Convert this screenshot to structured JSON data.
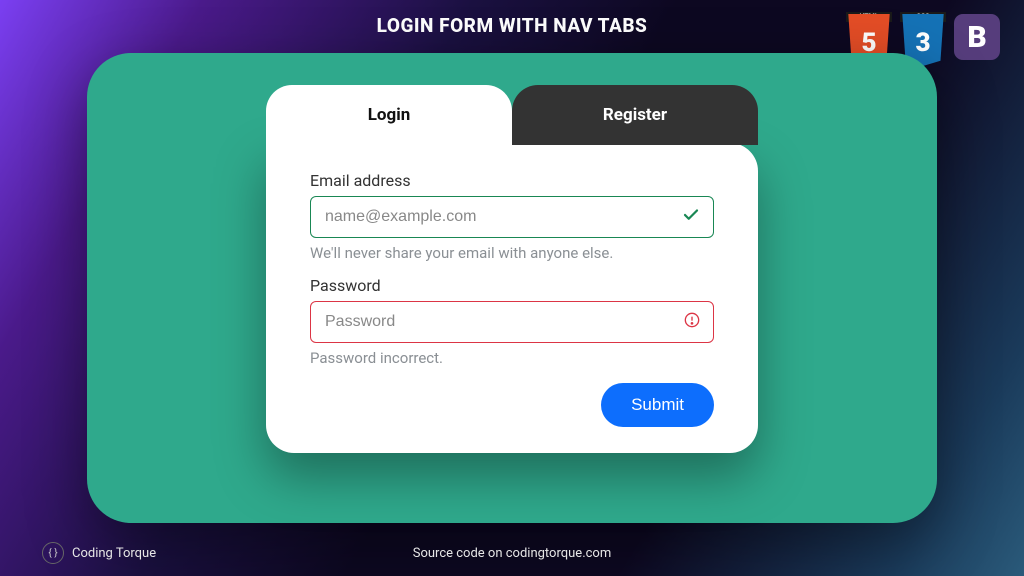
{
  "header": {
    "title": "LOGIN FORM WITH NAV TABS"
  },
  "badges": {
    "html_label": "HTML",
    "html_num": "5",
    "css_label": "CSS",
    "css_num": "3",
    "bootstrap_letter": "B"
  },
  "tabs": {
    "login": "Login",
    "register": "Register"
  },
  "form": {
    "email_label": "Email address",
    "email_placeholder": "name@example.com",
    "email_help": "We'll never share your email with anyone else.",
    "password_label": "Password",
    "password_placeholder": "Password",
    "password_error": "Password incorrect.",
    "submit_label": "Submit"
  },
  "footer": {
    "brand": "Coding Torque",
    "brand_icon": "{ }",
    "source": "Source code on codingtorque.com"
  }
}
